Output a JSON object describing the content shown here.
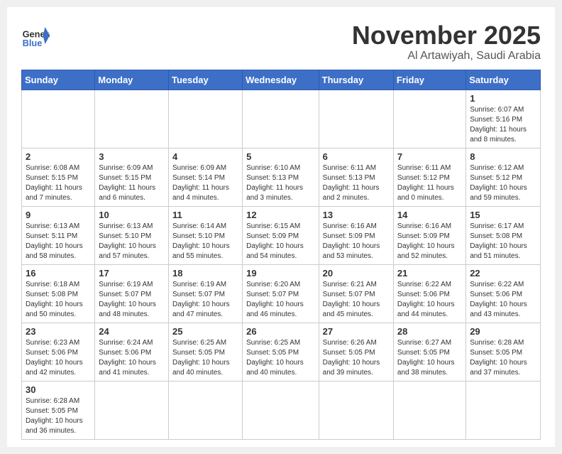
{
  "header": {
    "logo_general": "General",
    "logo_blue": "Blue",
    "title": "November 2025",
    "location": "Al Artawiyah, Saudi Arabia"
  },
  "days_of_week": [
    "Sunday",
    "Monday",
    "Tuesday",
    "Wednesday",
    "Thursday",
    "Friday",
    "Saturday"
  ],
  "weeks": [
    [
      {
        "day": "",
        "info": ""
      },
      {
        "day": "",
        "info": ""
      },
      {
        "day": "",
        "info": ""
      },
      {
        "day": "",
        "info": ""
      },
      {
        "day": "",
        "info": ""
      },
      {
        "day": "",
        "info": ""
      },
      {
        "day": "1",
        "info": "Sunrise: 6:07 AM\nSunset: 5:16 PM\nDaylight: 11 hours and 8 minutes."
      }
    ],
    [
      {
        "day": "2",
        "info": "Sunrise: 6:08 AM\nSunset: 5:15 PM\nDaylight: 11 hours and 7 minutes."
      },
      {
        "day": "3",
        "info": "Sunrise: 6:09 AM\nSunset: 5:15 PM\nDaylight: 11 hours and 6 minutes."
      },
      {
        "day": "4",
        "info": "Sunrise: 6:09 AM\nSunset: 5:14 PM\nDaylight: 11 hours and 4 minutes."
      },
      {
        "day": "5",
        "info": "Sunrise: 6:10 AM\nSunset: 5:13 PM\nDaylight: 11 hours and 3 minutes."
      },
      {
        "day": "6",
        "info": "Sunrise: 6:11 AM\nSunset: 5:13 PM\nDaylight: 11 hours and 2 minutes."
      },
      {
        "day": "7",
        "info": "Sunrise: 6:11 AM\nSunset: 5:12 PM\nDaylight: 11 hours and 0 minutes."
      },
      {
        "day": "8",
        "info": "Sunrise: 6:12 AM\nSunset: 5:12 PM\nDaylight: 10 hours and 59 minutes."
      }
    ],
    [
      {
        "day": "9",
        "info": "Sunrise: 6:13 AM\nSunset: 5:11 PM\nDaylight: 10 hours and 58 minutes."
      },
      {
        "day": "10",
        "info": "Sunrise: 6:13 AM\nSunset: 5:10 PM\nDaylight: 10 hours and 57 minutes."
      },
      {
        "day": "11",
        "info": "Sunrise: 6:14 AM\nSunset: 5:10 PM\nDaylight: 10 hours and 55 minutes."
      },
      {
        "day": "12",
        "info": "Sunrise: 6:15 AM\nSunset: 5:09 PM\nDaylight: 10 hours and 54 minutes."
      },
      {
        "day": "13",
        "info": "Sunrise: 6:16 AM\nSunset: 5:09 PM\nDaylight: 10 hours and 53 minutes."
      },
      {
        "day": "14",
        "info": "Sunrise: 6:16 AM\nSunset: 5:09 PM\nDaylight: 10 hours and 52 minutes."
      },
      {
        "day": "15",
        "info": "Sunrise: 6:17 AM\nSunset: 5:08 PM\nDaylight: 10 hours and 51 minutes."
      }
    ],
    [
      {
        "day": "16",
        "info": "Sunrise: 6:18 AM\nSunset: 5:08 PM\nDaylight: 10 hours and 50 minutes."
      },
      {
        "day": "17",
        "info": "Sunrise: 6:19 AM\nSunset: 5:07 PM\nDaylight: 10 hours and 48 minutes."
      },
      {
        "day": "18",
        "info": "Sunrise: 6:19 AM\nSunset: 5:07 PM\nDaylight: 10 hours and 47 minutes."
      },
      {
        "day": "19",
        "info": "Sunrise: 6:20 AM\nSunset: 5:07 PM\nDaylight: 10 hours and 46 minutes."
      },
      {
        "day": "20",
        "info": "Sunrise: 6:21 AM\nSunset: 5:07 PM\nDaylight: 10 hours and 45 minutes."
      },
      {
        "day": "21",
        "info": "Sunrise: 6:22 AM\nSunset: 5:06 PM\nDaylight: 10 hours and 44 minutes."
      },
      {
        "day": "22",
        "info": "Sunrise: 6:22 AM\nSunset: 5:06 PM\nDaylight: 10 hours and 43 minutes."
      }
    ],
    [
      {
        "day": "23",
        "info": "Sunrise: 6:23 AM\nSunset: 5:06 PM\nDaylight: 10 hours and 42 minutes."
      },
      {
        "day": "24",
        "info": "Sunrise: 6:24 AM\nSunset: 5:06 PM\nDaylight: 10 hours and 41 minutes."
      },
      {
        "day": "25",
        "info": "Sunrise: 6:25 AM\nSunset: 5:05 PM\nDaylight: 10 hours and 40 minutes."
      },
      {
        "day": "26",
        "info": "Sunrise: 6:25 AM\nSunset: 5:05 PM\nDaylight: 10 hours and 40 minutes."
      },
      {
        "day": "27",
        "info": "Sunrise: 6:26 AM\nSunset: 5:05 PM\nDaylight: 10 hours and 39 minutes."
      },
      {
        "day": "28",
        "info": "Sunrise: 6:27 AM\nSunset: 5:05 PM\nDaylight: 10 hours and 38 minutes."
      },
      {
        "day": "29",
        "info": "Sunrise: 6:28 AM\nSunset: 5:05 PM\nDaylight: 10 hours and 37 minutes."
      }
    ],
    [
      {
        "day": "30",
        "info": "Sunrise: 6:28 AM\nSunset: 5:05 PM\nDaylight: 10 hours and 36 minutes."
      },
      {
        "day": "",
        "info": ""
      },
      {
        "day": "",
        "info": ""
      },
      {
        "day": "",
        "info": ""
      },
      {
        "day": "",
        "info": ""
      },
      {
        "day": "",
        "info": ""
      },
      {
        "day": "",
        "info": ""
      }
    ]
  ]
}
